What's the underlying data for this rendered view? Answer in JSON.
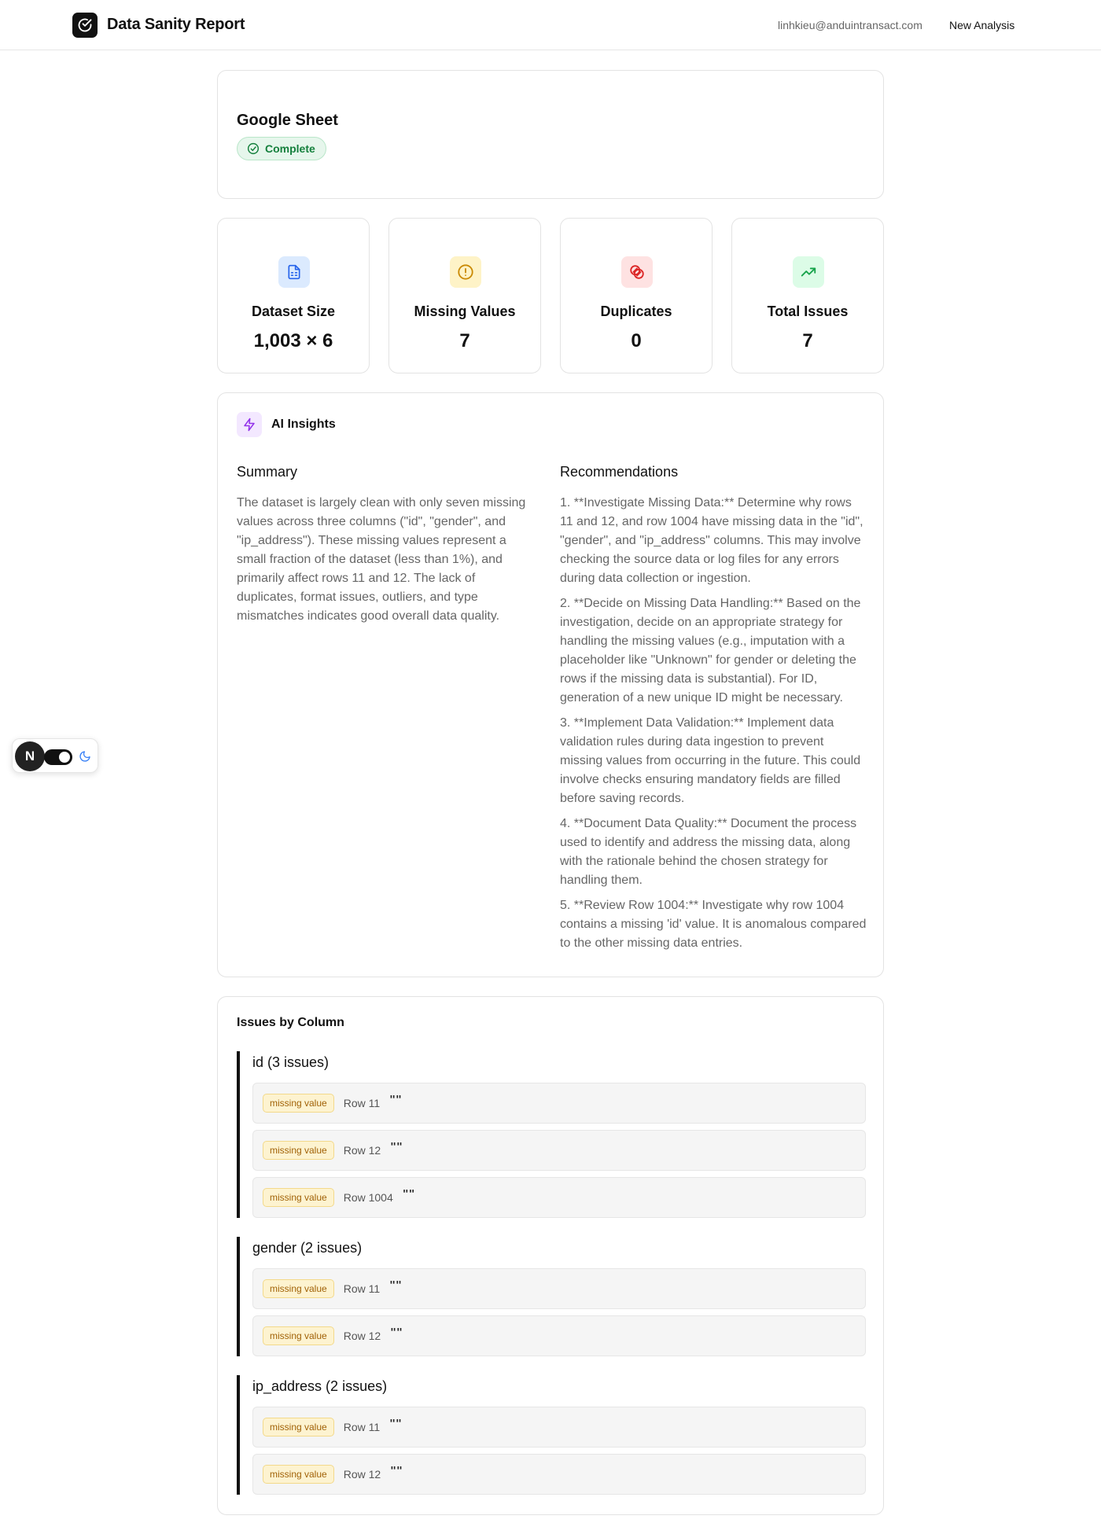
{
  "header": {
    "app_title": "Data Sanity Report",
    "user_email": "linhkieu@anduintransact.com",
    "new_analysis_label": "New Analysis"
  },
  "source": {
    "title": "Google Sheet",
    "status": "Complete",
    "status_color": "#15803d"
  },
  "stats": [
    {
      "label": "Dataset Size",
      "value": "1,003 × 6",
      "icon": "file-spreadsheet-icon",
      "color": "#2563eb"
    },
    {
      "label": "Missing Values",
      "value": "7",
      "icon": "alert-circle-icon",
      "color": "#ca8a04"
    },
    {
      "label": "Duplicates",
      "value": "0",
      "icon": "copy-icon",
      "color": "#dc2626"
    },
    {
      "label": "Total Issues",
      "value": "7",
      "icon": "trending-up-icon",
      "color": "#16a34a"
    }
  ],
  "insights": {
    "title": "AI Insights",
    "icon": "zap-icon",
    "summary_heading": "Summary",
    "summary_text": "The dataset is largely clean with only seven missing values across three columns (\"id\", \"gender\", and \"ip_address\"). These missing values represent a small fraction of the dataset (less than 1%), and primarily affect rows 11 and 12. The lack of duplicates, format issues, outliers, and type mismatches indicates good overall data quality.",
    "recommendations_heading": "Recommendations",
    "recommendations": [
      "1. **Investigate Missing Data:** Determine why rows 11 and 12, and row 1004 have missing data in the \"id\", \"gender\", and \"ip_address\" columns. This may involve checking the source data or log files for any errors during data collection or ingestion.",
      "2. **Decide on Missing Data Handling:** Based on the investigation, decide on an appropriate strategy for handling the missing values (e.g., imputation with a placeholder like \"Unknown\" for gender or deleting the rows if the missing data is substantial). For ID, generation of a new unique ID might be necessary.",
      "3. **Implement Data Validation:** Implement data validation rules during data ingestion to prevent missing values from occurring in the future. This could involve checks ensuring mandatory fields are filled before saving records.",
      "4. **Document Data Quality:** Document the process used to identify and address the missing data, along with the rationale behind the chosen strategy for handling them.",
      "5. **Review Row 1004:** Investigate why row 1004 contains a missing 'id' value. It is anomalous compared to the other missing data entries."
    ]
  },
  "issues": {
    "title": "Issues by Column",
    "groups": [
      {
        "title": "id (3 issues)",
        "rows": [
          {
            "type": "missing value",
            "row": "Row 11",
            "value": "\"\""
          },
          {
            "type": "missing value",
            "row": "Row 12",
            "value": "\"\""
          },
          {
            "type": "missing value",
            "row": "Row 1004",
            "value": "\"\""
          }
        ]
      },
      {
        "title": "gender (2 issues)",
        "rows": [
          {
            "type": "missing value",
            "row": "Row 11",
            "value": "\"\""
          },
          {
            "type": "missing value",
            "row": "Row 12",
            "value": "\"\""
          }
        ]
      },
      {
        "title": "ip_address (2 issues)",
        "rows": [
          {
            "type": "missing value",
            "row": "Row 11",
            "value": "\"\""
          },
          {
            "type": "missing value",
            "row": "Row 12",
            "value": "\"\""
          }
        ]
      }
    ]
  },
  "widget": {
    "avatar_letter": "N",
    "theme_toggle_on": true,
    "moon_icon": "moon-icon"
  }
}
